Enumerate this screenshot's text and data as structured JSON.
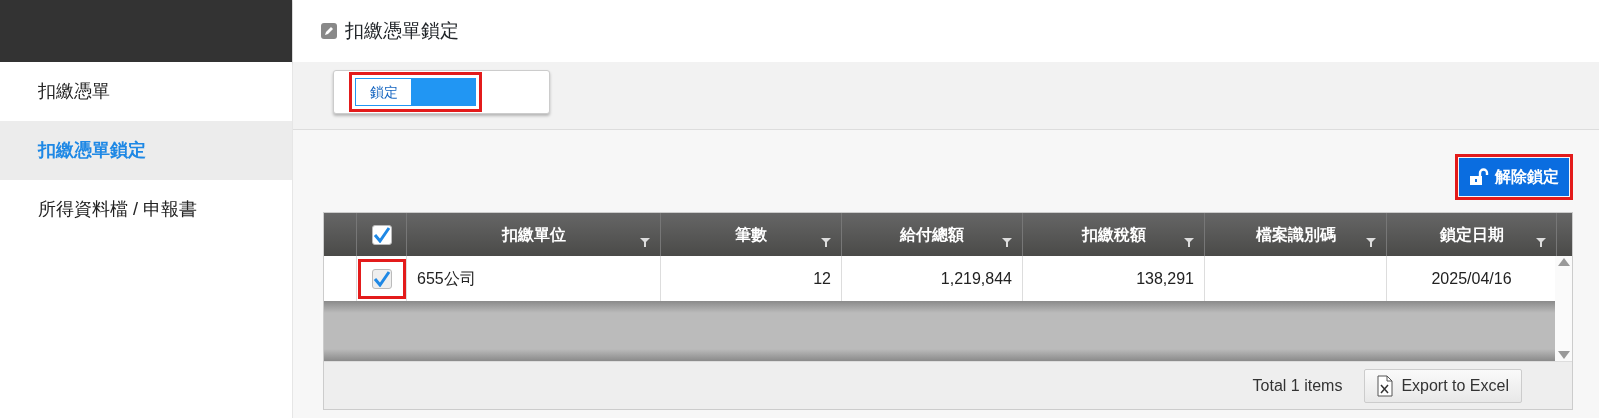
{
  "page_title": "扣繳憑單鎖定",
  "sidebar": {
    "items": [
      {
        "label": "扣繳憑單",
        "selected": false
      },
      {
        "label": "扣繳憑單鎖定",
        "selected": true
      },
      {
        "label": "所得資料檔 / 申報書",
        "selected": false
      }
    ]
  },
  "lock_switch": {
    "label": "鎖定",
    "on": true,
    "highlighted": true
  },
  "unlock_button": {
    "label": "解除鎖定",
    "highlighted": true
  },
  "table": {
    "select_all": {
      "checked": true
    },
    "columns": [
      {
        "label": "扣繳單位"
      },
      {
        "label": "筆數"
      },
      {
        "label": "給付總額"
      },
      {
        "label": "扣繳稅額"
      },
      {
        "label": "檔案識別碼"
      },
      {
        "label": "鎖定日期"
      }
    ],
    "rows": [
      {
        "checked": true,
        "highlighted": true,
        "cells": [
          "655公司",
          "12",
          "1,219,844",
          "138,291",
          "",
          "2025/04/16"
        ]
      }
    ]
  },
  "footer": {
    "total": "Total 1 items",
    "export_button": "Export to Excel"
  }
}
